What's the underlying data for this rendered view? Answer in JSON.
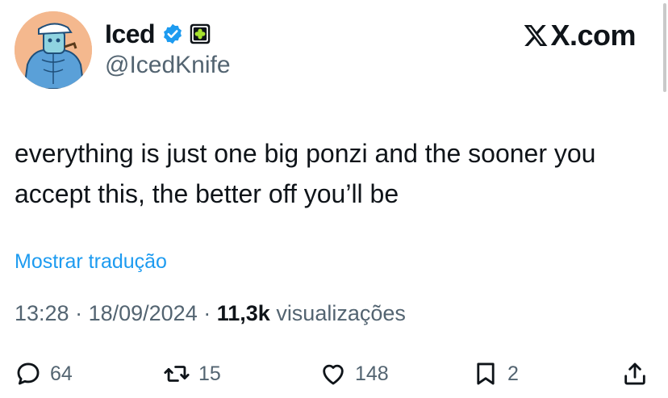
{
  "author": {
    "name": "Iced",
    "handle": "@IcedKnife",
    "avatar_icon": "avatar-cartoon-muscular-character",
    "verified_icon": "verified-badge-icon",
    "affiliation_icon": "affiliate-badge-icon"
  },
  "brand": {
    "text": "X.com"
  },
  "tweet": {
    "text": "everything is just one big ponzi and the sooner you accept this, the better off you’ll be",
    "translate_link": "Mostrar tradução",
    "time": "13:28",
    "date": "18/09/2024",
    "views_count": "11,3k",
    "views_label": "visualizações"
  },
  "actions": {
    "replies": "64",
    "reposts": "15",
    "likes": "148",
    "bookmarks": "2"
  },
  "colors": {
    "accent": "#1d9bf0",
    "secondary_text": "#536471",
    "primary_text": "#0f1419"
  }
}
